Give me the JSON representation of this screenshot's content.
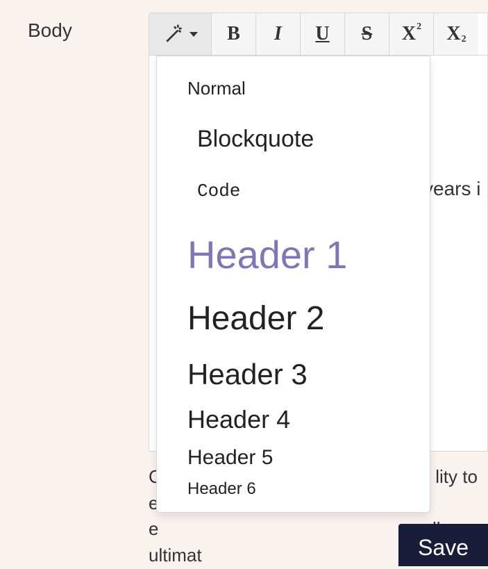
{
  "field": {
    "label": "Body"
  },
  "toolbar": {
    "bold_label": "B",
    "italic_label": "I",
    "underline_label": "U",
    "strike_label": "S",
    "sup_base": "X",
    "sup_exp": "2",
    "sub_base": "X",
    "sub_exp": "2"
  },
  "dropdown": {
    "normal": "Normal",
    "blockquote": "Blockquote",
    "code": "Code",
    "h1": "Header 1",
    "h2": "Header 2",
    "h3": "Header 3",
    "h4": "Header 4",
    "h5": "Header 5",
    "h6": "Header 6"
  },
  "editor": {
    "visible_fragment": "years i"
  },
  "hint": {
    "line1_left": "C",
    "line1_right": "lity to ec",
    "line2_left": "e",
    "line2_right": "ll ultimat"
  },
  "actions": {
    "save": "Save"
  }
}
